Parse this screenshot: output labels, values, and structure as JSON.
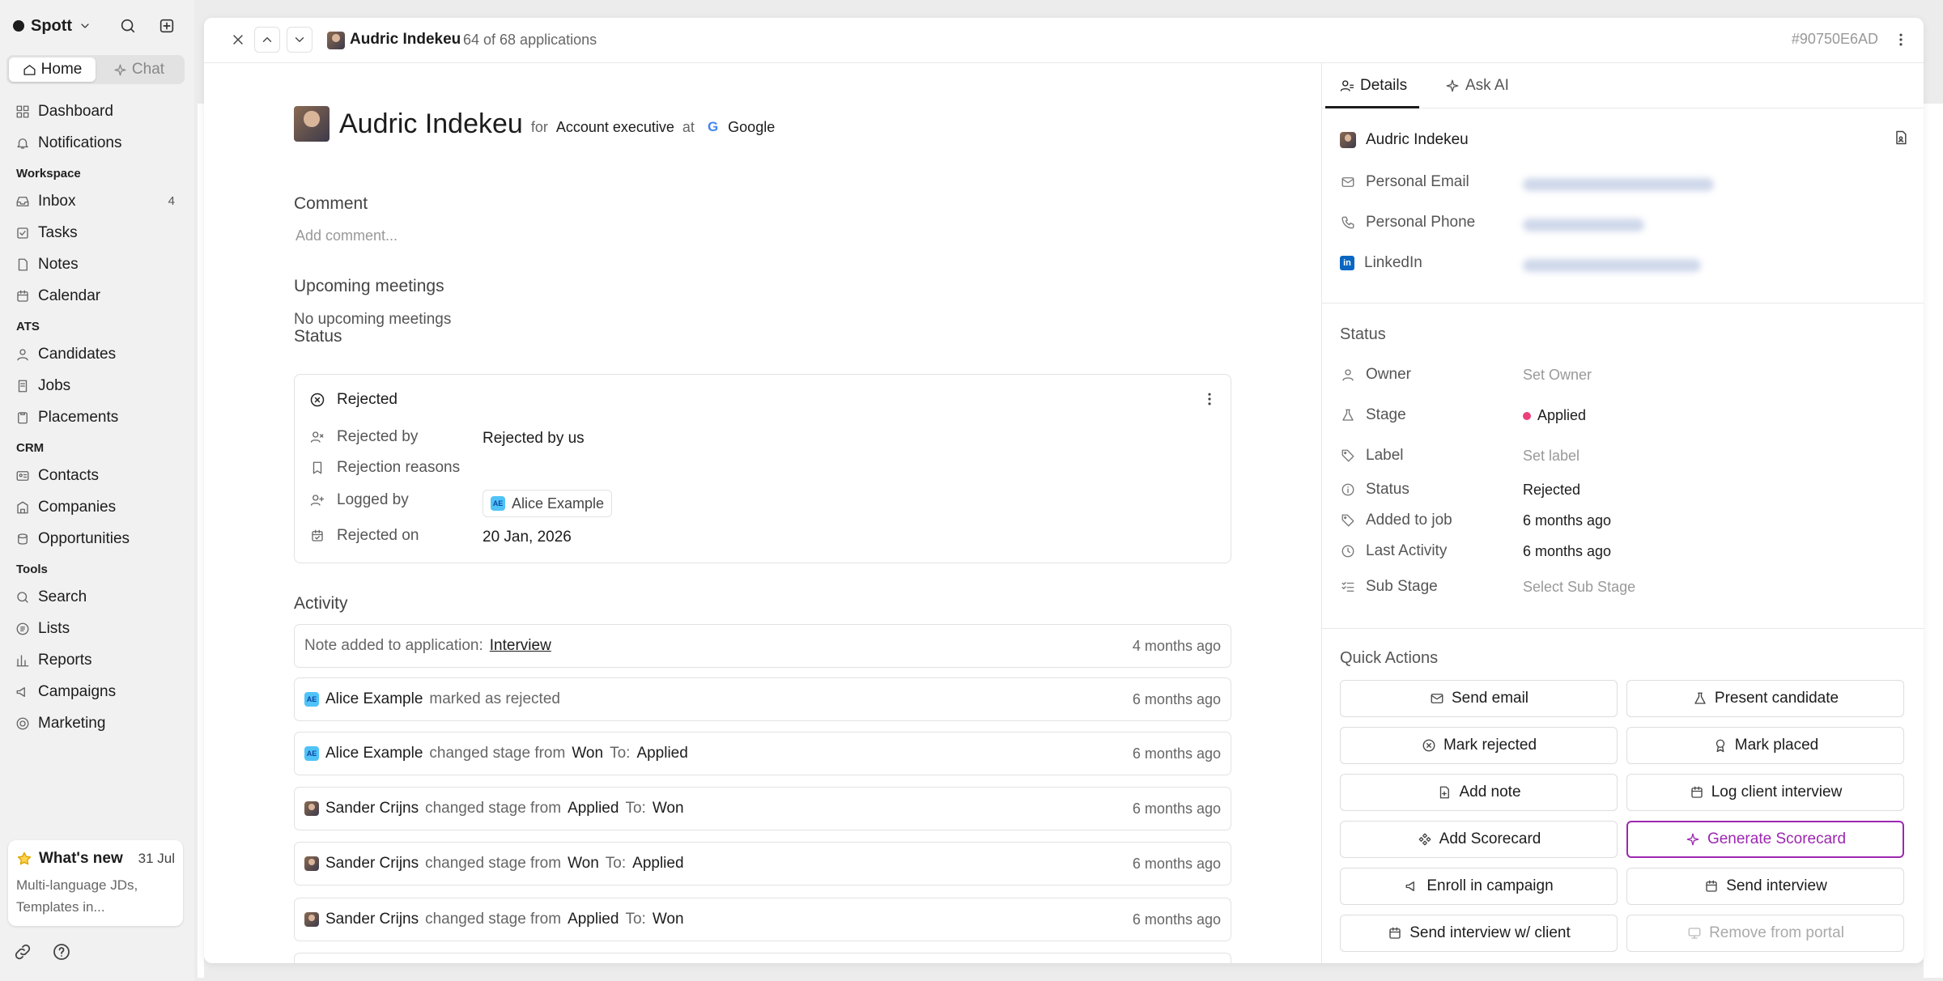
{
  "sidebar": {
    "brand": "Spott",
    "tabs": {
      "home": "Home",
      "chat": "Chat"
    },
    "items": {
      "dashboard": "Dashboard",
      "notifications": "Notifications",
      "workspace": "Workspace",
      "inbox": "Inbox",
      "inbox_count": "4",
      "tasks": "Tasks",
      "notes": "Notes",
      "calendar": "Calendar",
      "ats": "ATS",
      "candidates": "Candidates",
      "jobs": "Jobs",
      "placements": "Placements",
      "crm": "CRM",
      "contacts": "Contacts",
      "companies": "Companies",
      "opportunities": "Opportunities",
      "tools": "Tools",
      "search": "Search",
      "lists": "Lists",
      "reports": "Reports",
      "campaigns": "Campaigns",
      "marketing": "Marketing"
    },
    "whats_new": {
      "title": "What's new",
      "date": "31 Jul",
      "text": "Multi-language JDs, Templates in..."
    }
  },
  "header": {
    "name": "Audric Indekeu",
    "count": "64 of 68 applications",
    "id": "#90750E6AD"
  },
  "main": {
    "name": "Audric Indekeu",
    "for": "for",
    "role": "Account executive",
    "at": "at",
    "company": "Google",
    "comment_label": "Comment",
    "comment_placeholder": "Add comment...",
    "meetings_label": "Upcoming meetings",
    "meetings_empty": "No upcoming meetings",
    "status_label": "Status",
    "status": {
      "state": "Rejected",
      "rejected_by_label": "Rejected by",
      "rejected_by": "Rejected by us",
      "reasons_label": "Rejection reasons",
      "logged_by_label": "Logged by",
      "logged_by_initials": "AE",
      "logged_by": "Alice Example",
      "rejected_on_label": "Rejected on",
      "rejected_on": "20 Jan, 2026"
    },
    "activity_label": "Activity",
    "activity": [
      {
        "who": "",
        "text": "Note added to application:",
        "link": "Interview",
        "time": "4 months ago"
      },
      {
        "who": "Alice Example",
        "text": "marked as rejected",
        "time": "6 months ago"
      },
      {
        "who": "Alice Example",
        "text": "changed stage from",
        "from": "Won",
        "to_label": "To:",
        "to": "Applied",
        "time": "6 months ago"
      },
      {
        "who": "Sander Crijns",
        "text": "changed stage from",
        "from": "Applied",
        "to_label": "To:",
        "to": "Won",
        "time": "6 months ago"
      },
      {
        "who": "Sander Crijns",
        "text": "changed stage from",
        "from": "Won",
        "to_label": "To:",
        "to": "Applied",
        "time": "6 months ago"
      },
      {
        "who": "Sander Crijns",
        "text": "changed stage from",
        "from": "Applied",
        "to_label": "To:",
        "to": "Won",
        "time": "6 months ago"
      }
    ]
  },
  "panel": {
    "tabs": {
      "details": "Details",
      "ask_ai": "Ask AI"
    },
    "candidate": "Audric Indekeu",
    "contact": {
      "email": "Personal Email",
      "phone": "Personal Phone",
      "linkedin": "LinkedIn"
    },
    "status_title": "Status",
    "fields": {
      "owner_label": "Owner",
      "owner": "Set Owner",
      "stage_label": "Stage",
      "stage": "Applied",
      "stage_color": "#ec407a",
      "label_label": "Label",
      "label": "Set label",
      "status_label": "Status",
      "status": "Rejected",
      "added_label": "Added to job",
      "added": "6 months ago",
      "last_label": "Last Activity",
      "last": "6 months ago",
      "sub_label": "Sub Stage",
      "sub": "Select Sub Stage"
    },
    "quick_title": "Quick Actions",
    "quick": {
      "send_email": "Send email",
      "present": "Present candidate",
      "reject": "Mark rejected",
      "placed": "Mark placed",
      "note": "Add note",
      "log_interview": "Log client interview",
      "scorecard": "Add Scorecard",
      "gen_scorecard": "Generate Scorecard",
      "enroll": "Enroll in campaign",
      "send_interview": "Send interview",
      "send_interview_client": "Send interview w/ client",
      "remove_portal": "Remove from portal"
    }
  }
}
